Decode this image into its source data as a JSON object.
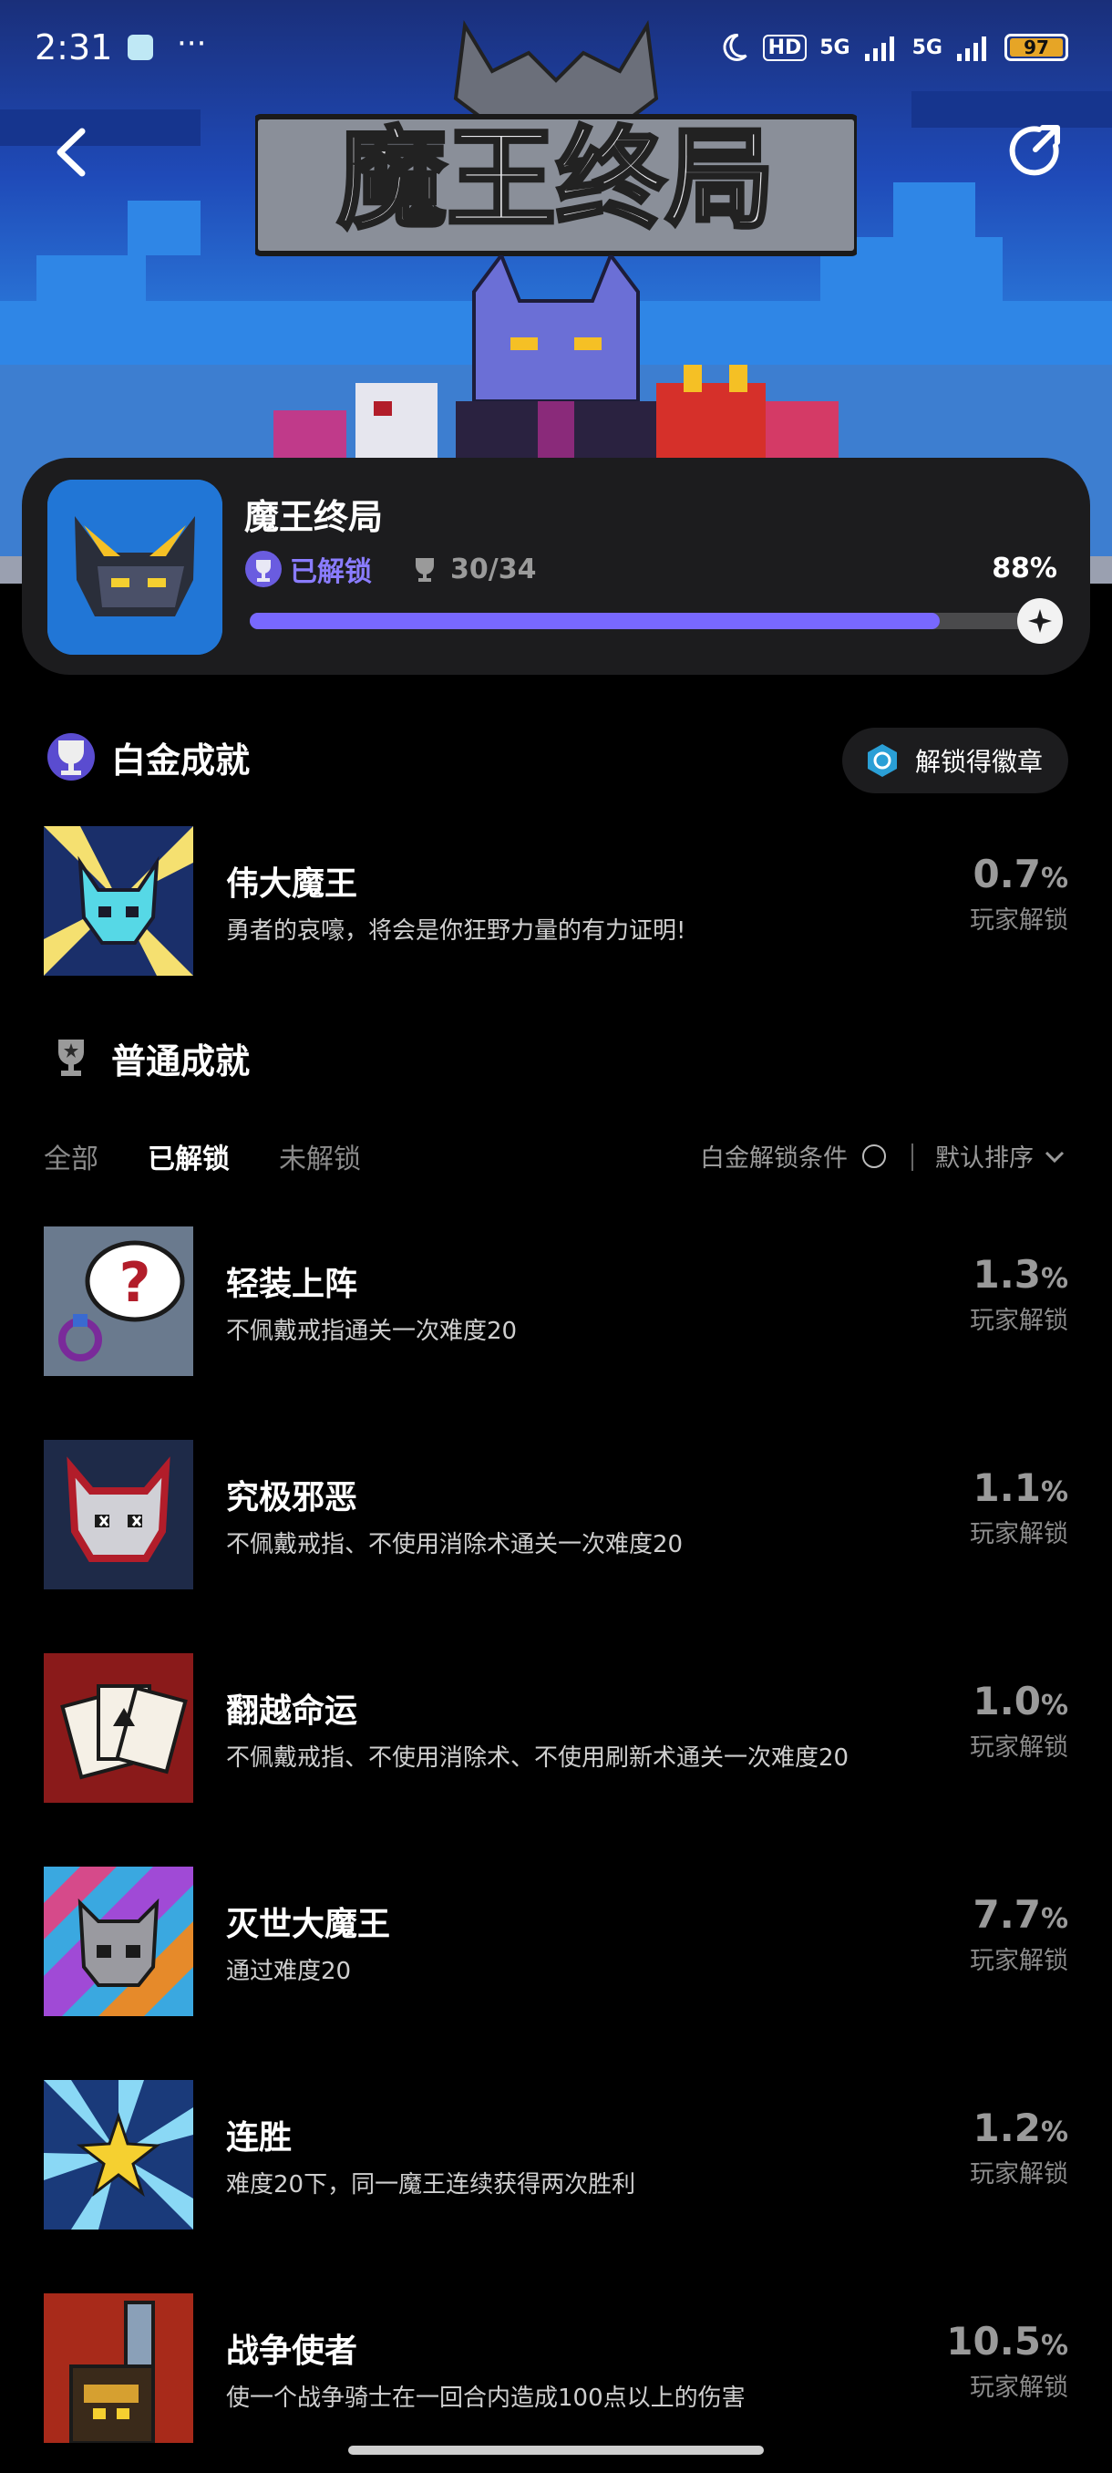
{
  "status_bar": {
    "time": "2:31",
    "dots": "···",
    "hd": "HD",
    "net1": "5G",
    "net2": "5G",
    "battery": "97"
  },
  "hero": {
    "logo_text": "魔王终局"
  },
  "game": {
    "title": "魔王终局",
    "unlock_status": "已解锁",
    "trophy_count": "30/34",
    "percent_label": "88%",
    "progress": 0.88
  },
  "platinum_section": {
    "title": "白金成就",
    "badge_button": "解锁得徽章",
    "achievement": {
      "name": "伟大魔王",
      "desc": "勇者的哀嚎，将会是你狂野力量的有力证明!",
      "rate": "0.7",
      "unit": "%",
      "label": "玩家解锁"
    }
  },
  "normal_section": {
    "title": "普通成就",
    "tabs": [
      "全部",
      "已解锁",
      "未解锁"
    ],
    "active_tab": "已解锁",
    "condition_label": "白金解锁条件",
    "sort_label": "默认排序",
    "achievements": [
      {
        "name": "轻装上阵",
        "desc": "不佩戴戒指通关一次难度20",
        "rate": "1.3",
        "unit": "%",
        "label": "玩家解锁"
      },
      {
        "name": "究极邪恶",
        "desc": "不佩戴戒指、不使用消除术通关一次难度20",
        "rate": "1.1",
        "unit": "%",
        "label": "玩家解锁"
      },
      {
        "name": "翻越命运",
        "desc": "不佩戴戒指、不使用消除术、不使用刷新术通关一次难度20",
        "rate": "1.0",
        "unit": "%",
        "label": "玩家解锁"
      },
      {
        "name": "灭世大魔王",
        "desc": "通过难度20",
        "rate": "7.7",
        "unit": "%",
        "label": "玩家解锁"
      },
      {
        "name": "连胜",
        "desc": "难度20下，同一魔王连续获得两次胜利",
        "rate": "1.2",
        "unit": "%",
        "label": "玩家解锁"
      },
      {
        "name": "战争使者",
        "desc": "使一个战争骑士在一回合内造成100点以上的伤害",
        "rate": "10.5",
        "unit": "%",
        "label": "玩家解锁"
      }
    ]
  }
}
